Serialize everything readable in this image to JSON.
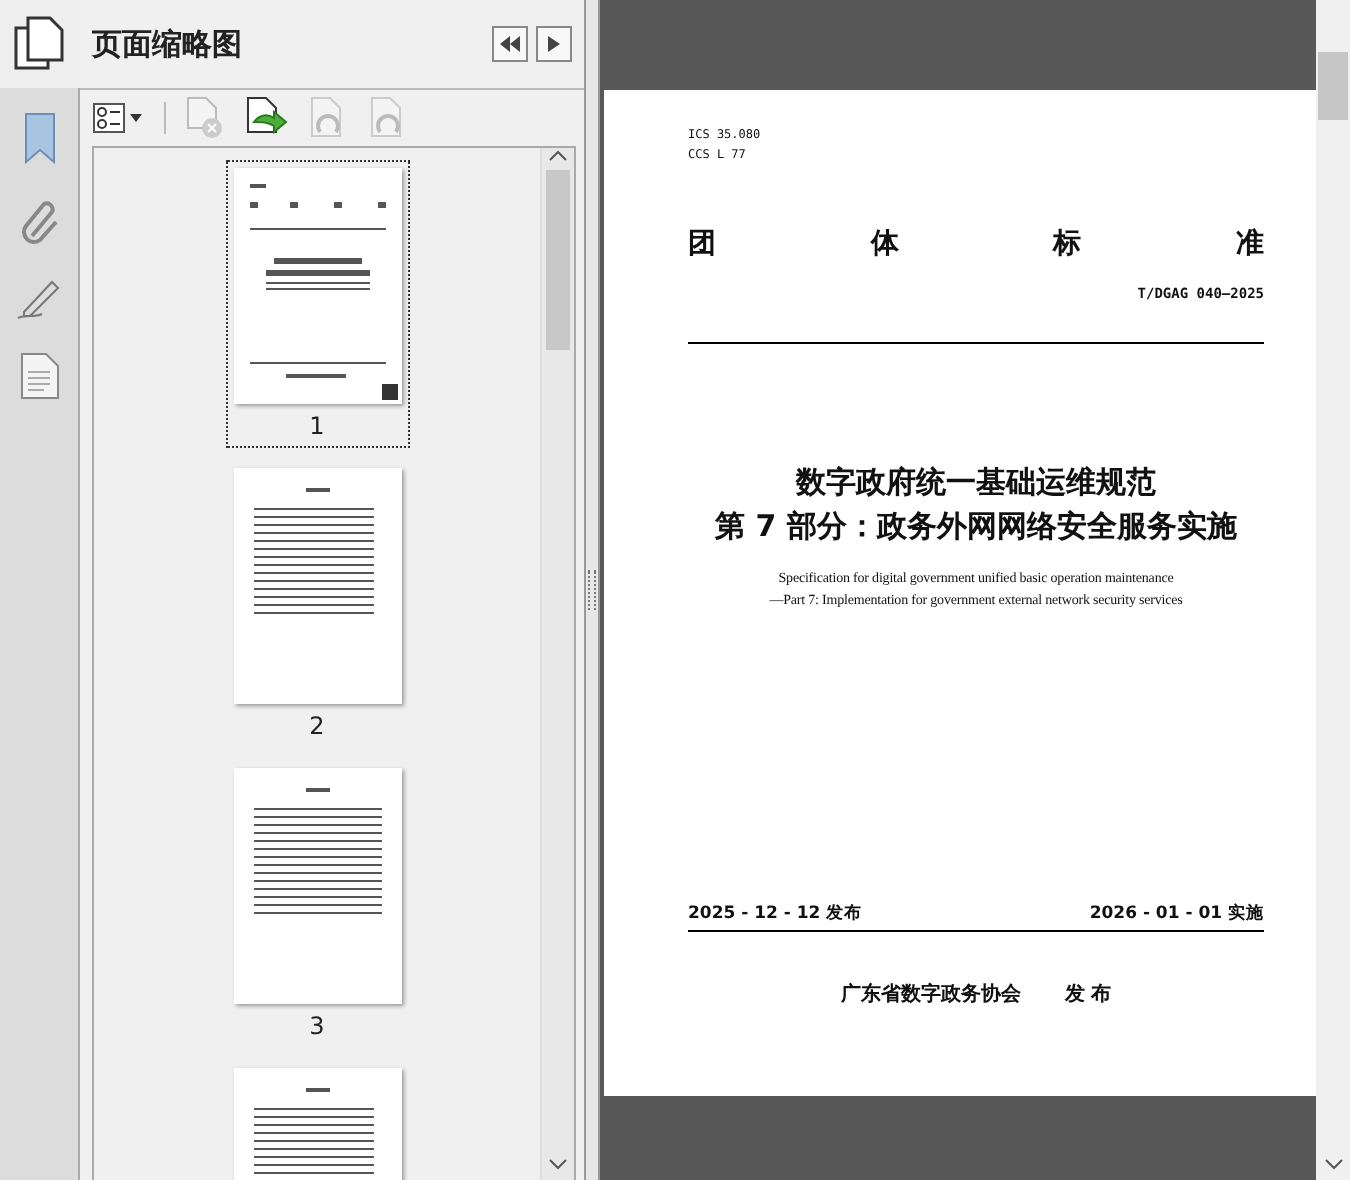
{
  "panel": {
    "title": "页面缩略图"
  },
  "thumbnails": [
    {
      "label": "1",
      "selected": true
    },
    {
      "label": "2",
      "selected": false
    },
    {
      "label": "3",
      "selected": false
    },
    {
      "selected": false
    }
  ],
  "page": {
    "codes": [
      "ICS 35.080",
      "CCS L 77"
    ],
    "category": [
      "团",
      "体",
      "标",
      "准"
    ],
    "number": "T/DGAG 040—2025",
    "title_lines": [
      "数字政府统一基础运维规范",
      "第 7 部分：政务外网网络安全服务实施"
    ],
    "english_lines": [
      "Specification for digital government unified basic operation maintenance",
      "—Part 7: Implementation for government external network security services"
    ],
    "issue_date": "2025 - 12 - 12 发布",
    "effective_date": "2026 - 01 - 01 实施",
    "publisher": "广东省数字政务协会",
    "publish_word": "发 布"
  }
}
